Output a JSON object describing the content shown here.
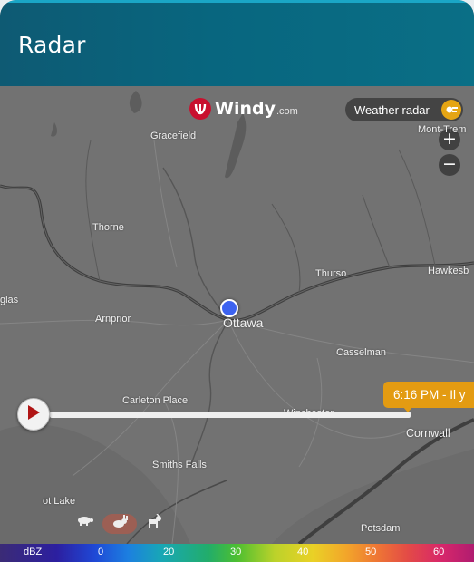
{
  "header": {
    "title": "Radar"
  },
  "map": {
    "brand": {
      "name": "Windy",
      "domain": ".com"
    },
    "layer_chip": {
      "label": "Weather radar",
      "icon": "radar-icon",
      "accent": "#e5a514"
    },
    "zoom": {
      "in": "+",
      "out": "−"
    },
    "places": {
      "gracefield": "Gracefield",
      "mont_tremblant": "Mont-Trem",
      "thorne": "Thorne",
      "thurso": "Thurso",
      "hawkesbury": "Hawkesb",
      "glas": "glas",
      "arnprior": "Arnprior",
      "ottawa": "Ottawa",
      "casselman": "Casselman",
      "carleton_place": "Carleton Place",
      "winchester": "Winchester",
      "cornwall": "Cornwall",
      "smiths_falls": "Smiths Falls",
      "ot_lake": "ot Lake",
      "potsdam": "Potsdam"
    },
    "location_marker_color": "#3d63f0"
  },
  "timeline": {
    "time_label": "6:16 PM - Il y",
    "accent": "#e39b12",
    "play_icon": "play-icon",
    "speeds": [
      "turtle-icon",
      "rabbit-icon",
      "goat-icon"
    ],
    "active_speed": "rabbit-icon"
  },
  "legend": {
    "unit": "dBZ",
    "ticks": [
      "0",
      "20",
      "30",
      "40",
      "50",
      "60"
    ]
  }
}
